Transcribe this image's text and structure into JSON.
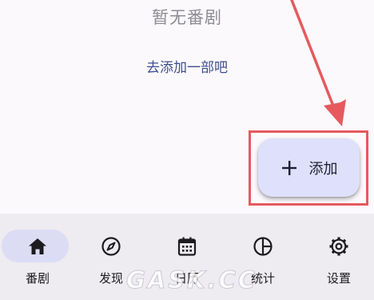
{
  "empty_state": {
    "title": "暂无番剧",
    "action_link": "去添加一部吧"
  },
  "fab": {
    "icon": "plus-icon",
    "label": "添加"
  },
  "bottom_nav": {
    "items": [
      {
        "label": "番剧",
        "icon": "home-icon",
        "active": true
      },
      {
        "label": "发现",
        "icon": "compass-icon",
        "active": false
      },
      {
        "label": "日历",
        "icon": "calendar-icon",
        "active": false
      },
      {
        "label": "统计",
        "icon": "pie-chart-icon",
        "active": false
      },
      {
        "label": "设置",
        "icon": "gear-icon",
        "active": false
      }
    ]
  },
  "watermark": "GASK.CC",
  "colors": {
    "accent": "#dfe0fb",
    "annotation": "#e65a5e",
    "link": "#3f4f8f",
    "nav_background": "#eeebf1"
  }
}
